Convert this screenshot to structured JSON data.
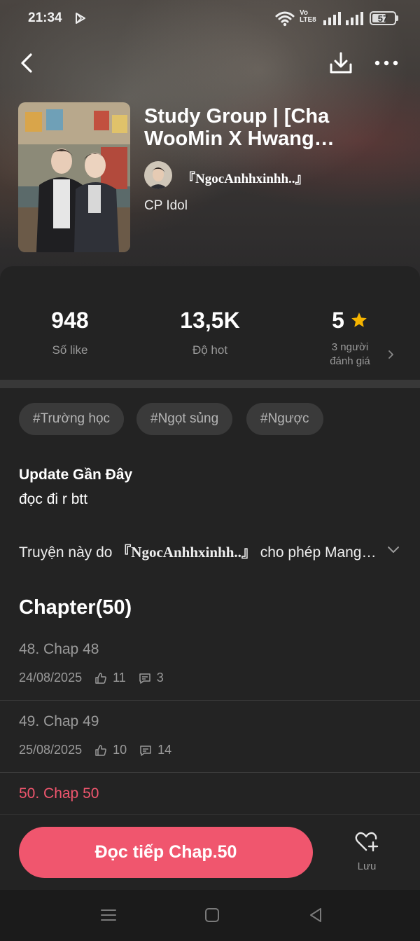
{
  "status_bar": {
    "time": "21:34",
    "network_label_top": "Vo",
    "network_label_bottom": "LTE8",
    "battery": "57"
  },
  "story": {
    "title": "Study Group | [Cha WooMin X Hwang Minhyun] Rung Động",
    "author": "『NgocAnhhxinhh..』",
    "category": "CP Idol"
  },
  "stats": {
    "likes_value": "948",
    "likes_label": "Số like",
    "hot_value": "13,5K",
    "hot_label": "Độ hot",
    "rating_value": "5",
    "rating_label_line1": "3 người",
    "rating_label_line2": "đánh giá"
  },
  "tags": [
    "#Trường học",
    "#Ngọt sủng",
    "#Ngược"
  ],
  "update": {
    "title": "Update Gần Đây",
    "text": "đọc đi r btt"
  },
  "permission": {
    "prefix": "Truyện này do ",
    "author": "『NgocAnhhxinhh..』",
    "suffix": " cho phép Mangatoon đăng tải"
  },
  "chapters_title": "Chapter(50)",
  "chapters": [
    {
      "name": "48. Chap 48",
      "date": "24/08/2025",
      "likes": "11",
      "comments": "3"
    },
    {
      "name": "49. Chap 49",
      "date": "25/08/2025",
      "likes": "10",
      "comments": "14"
    },
    {
      "name": "50. Chap 50"
    }
  ],
  "actions": {
    "read_label": "Đọc tiếp Chap.50",
    "save_label": "Lưu"
  },
  "colors": {
    "accent": "#f0566e",
    "star": "#f5b400",
    "background": "#232323"
  }
}
